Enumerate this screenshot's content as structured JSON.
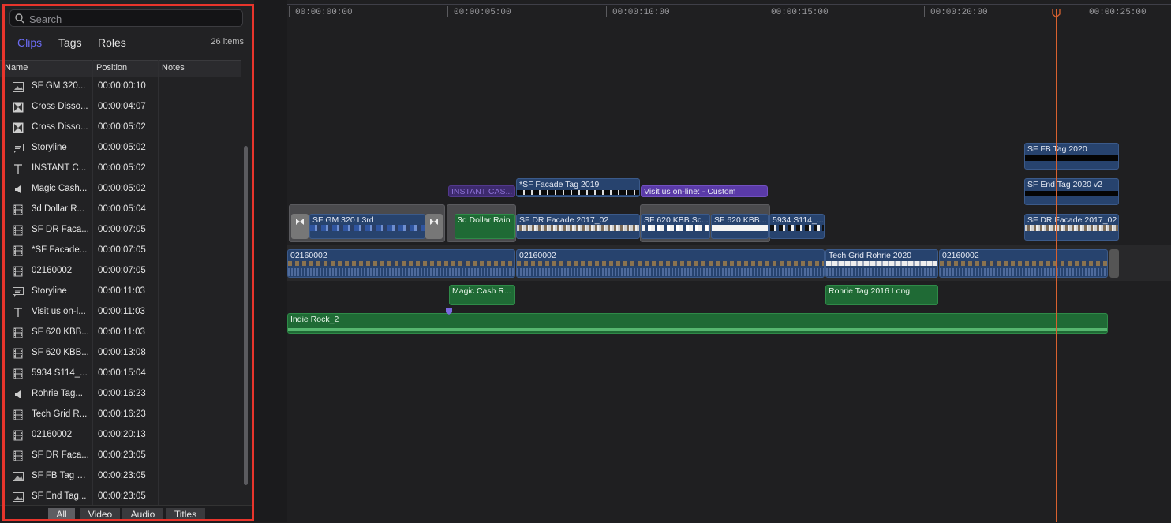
{
  "index": {
    "search_placeholder": "Search",
    "tabs": [
      {
        "label": "Clips",
        "active": true
      },
      {
        "label": "Tags",
        "active": false
      },
      {
        "label": "Roles",
        "active": false
      }
    ],
    "item_count": "26 items",
    "columns": {
      "name": "Name",
      "position": "Position",
      "notes": "Notes"
    },
    "rows": [
      {
        "icon": "image-icon",
        "name": "SF GM 320...",
        "position": "00:00:00:10"
      },
      {
        "icon": "transition-icon",
        "name": "Cross Disso...",
        "position": "00:00:04:07"
      },
      {
        "icon": "transition-icon",
        "name": "Cross Disso...",
        "position": "00:00:05:02"
      },
      {
        "icon": "storyline-icon",
        "name": "Storyline",
        "position": "00:00:05:02"
      },
      {
        "icon": "title-icon",
        "name": "INSTANT C...",
        "position": "00:00:05:02"
      },
      {
        "icon": "audio-icon",
        "name": "Magic Cash...",
        "position": "00:00:05:02"
      },
      {
        "icon": "film-icon",
        "name": "3d Dollar R...",
        "position": "00:00:05:04"
      },
      {
        "icon": "film-icon",
        "name": "SF DR Faca...",
        "position": "00:00:07:05"
      },
      {
        "icon": "film-icon",
        "name": "*SF Facade...",
        "position": "00:00:07:05"
      },
      {
        "icon": "film-icon",
        "name": "02160002",
        "position": "00:00:07:05"
      },
      {
        "icon": "storyline-icon",
        "name": "Storyline",
        "position": "00:00:11:03"
      },
      {
        "icon": "title-icon",
        "name": "Visit us on-l...",
        "position": "00:00:11:03"
      },
      {
        "icon": "film-icon",
        "name": "SF 620 KBB...",
        "position": "00:00:11:03"
      },
      {
        "icon": "film-icon",
        "name": "SF 620 KBB...",
        "position": "00:00:13:08"
      },
      {
        "icon": "film-icon",
        "name": "5934 S114_...",
        "position": "00:00:15:04"
      },
      {
        "icon": "audio-icon",
        "name": "Rohrie Tag...",
        "position": "00:00:16:23"
      },
      {
        "icon": "film-icon",
        "name": "Tech Grid R...",
        "position": "00:00:16:23"
      },
      {
        "icon": "film-icon",
        "name": "02160002",
        "position": "00:00:20:13"
      },
      {
        "icon": "film-icon",
        "name": "SF DR Faca...",
        "position": "00:00:23:05"
      },
      {
        "icon": "image-icon",
        "name": "SF FB Tag 2...",
        "position": "00:00:23:05"
      },
      {
        "icon": "image-icon",
        "name": "SF End Tag...",
        "position": "00:00:23:05"
      }
    ],
    "filters": [
      {
        "label": "All",
        "active": true
      },
      {
        "label": "Video",
        "active": false
      },
      {
        "label": "Audio",
        "active": false
      },
      {
        "label": "Titles",
        "active": false
      }
    ]
  },
  "timeline": {
    "ruler_labels": [
      "00:00:00:00",
      "00:00:05:00",
      "00:00:10:00",
      "00:00:15:00",
      "00:00:20:00",
      "00:00:25:00"
    ],
    "clips": {
      "sf_gm_320": "SF GM 320 L3rd",
      "instant_cas": "INSTANT CAS...",
      "three_d_dollar": "3d Dollar Rain",
      "sf_facade_2019": "*SF Facade Tag 2019",
      "visit_us": "Visit us on-line: - Custom",
      "sf_dr_facade_1": "SF DR Facade 2017_02",
      "sf_620_kbb_1": "SF 620 KBB Sc...",
      "sf_620_kbb_2": "SF 620 KBB...",
      "s5934": "5934 S114_...",
      "sf_fb_tag": "SF FB Tag 2020",
      "sf_end_tag": "SF End Tag 2020 v2",
      "sf_dr_facade_2": "SF DR Facade 2017_02",
      "primary_1": "02160002",
      "primary_2": "02160002",
      "tech_grid": "Tech Grid Rohrie 2020",
      "primary_3": "02160002",
      "magic_cash": "Magic Cash R...",
      "rohrie_tag": "Rohrie Tag 2016 Long",
      "indie_rock": "Indie Rock_2"
    }
  },
  "colors": {
    "highlight": "#e8352c",
    "active_tab": "#6b6bf2",
    "video_clip": "#27436e",
    "audio_clip": "#1f6a35",
    "title_clip": "#5a3aa8",
    "playhead": "#d8612f"
  }
}
